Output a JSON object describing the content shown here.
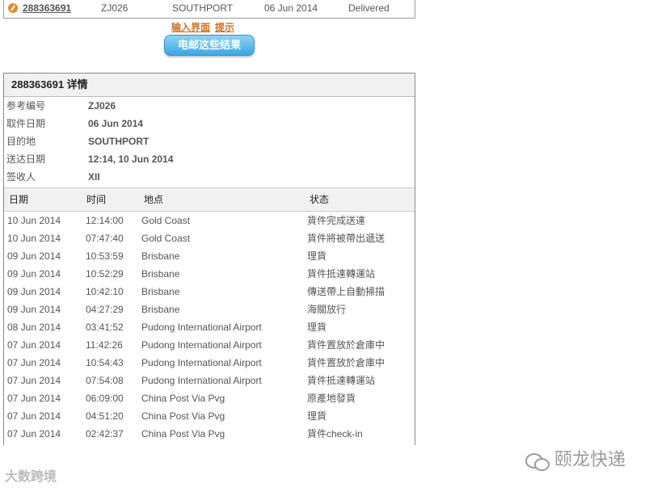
{
  "summary": {
    "tracking_number": "288363691",
    "reference": "ZJ026",
    "destination": "SOUTHPORT",
    "date": "06 Jun 2014",
    "status": "Delivered"
  },
  "links": {
    "input_page": "输入界面",
    "tips": "提示"
  },
  "email_button": "电邮这些结果",
  "details": {
    "title": "288363691 详情",
    "fields": [
      {
        "label": "参考编号",
        "value": "ZJ026"
      },
      {
        "label": "取件日期",
        "value": "06 Jun 2014"
      },
      {
        "label": "目的地",
        "value": "SOUTHPORT"
      },
      {
        "label": "送达日期",
        "value": "12:14, 10 Jun 2014"
      },
      {
        "label": "签收人",
        "value": "XII"
      }
    ],
    "columns": {
      "date": "日期",
      "time": "时间",
      "location": "地点",
      "status": "状态"
    },
    "events": [
      {
        "date": "10 Jun 2014",
        "time": "12:14:00",
        "location": "Gold Coast",
        "status": "貨件完成送達"
      },
      {
        "date": "10 Jun 2014",
        "time": "07:47:40",
        "location": "Gold Coast",
        "status": "貨件將被帶出遞送"
      },
      {
        "date": "09 Jun 2014",
        "time": "10:53:59",
        "location": "Brisbane",
        "status": "理貨"
      },
      {
        "date": "09 Jun 2014",
        "time": "10:52:29",
        "location": "Brisbane",
        "status": "貨件抵達轉運站"
      },
      {
        "date": "09 Jun 2014",
        "time": "10:42:10",
        "location": "Brisbane",
        "status": "傳送帶上自動掃描"
      },
      {
        "date": "09 Jun 2014",
        "time": "04:27:29",
        "location": "Brisbane",
        "status": "海關放行"
      },
      {
        "date": "08 Jun 2014",
        "time": "03:41:52",
        "location": "Pudong International Airport",
        "status": "理貨"
      },
      {
        "date": "07 Jun 2014",
        "time": "11:42:26",
        "location": "Pudong International Airport",
        "status": "貨件置放於倉庫中"
      },
      {
        "date": "07 Jun 2014",
        "time": "10:54:43",
        "location": "Pudong International Airport",
        "status": "貨件置放於倉庫中"
      },
      {
        "date": "07 Jun 2014",
        "time": "07:54:08",
        "location": "Pudong International Airport",
        "status": "貨件抵達轉運站"
      },
      {
        "date": "07 Jun 2014",
        "time": "06:09:00",
        "location": "China Post Via Pvg",
        "status": "原產地發貨"
      },
      {
        "date": "07 Jun 2014",
        "time": "04:51:20",
        "location": "China Post Via Pvg",
        "status": "理貨"
      },
      {
        "date": "07 Jun 2014",
        "time": "02:42:37",
        "location": "China Post Via Pvg",
        "status": "貨件check-in"
      }
    ]
  },
  "watermarks": {
    "left": "大数跨境",
    "right": "颐龙快递"
  }
}
